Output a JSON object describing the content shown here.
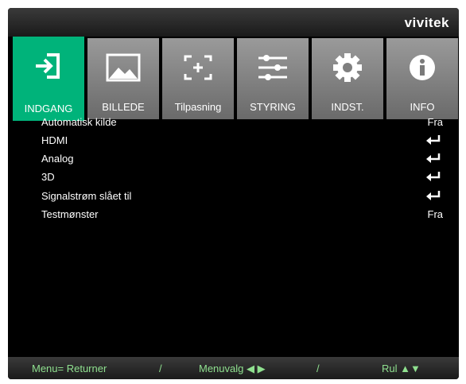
{
  "brand": "vivitek",
  "tabs": [
    {
      "label": "INDGANG",
      "icon": "input-icon",
      "active": true
    },
    {
      "label": "BILLEDE",
      "icon": "image-icon",
      "active": false
    },
    {
      "label": "Tilpasning",
      "icon": "adjust-icon",
      "active": false
    },
    {
      "label": "STYRING",
      "icon": "sliders-icon",
      "active": false
    },
    {
      "label": "INDST.",
      "icon": "gear-icon",
      "active": false
    },
    {
      "label": "INFO",
      "icon": "info-icon",
      "active": false
    }
  ],
  "menu": [
    {
      "label": "Automatisk kilde",
      "value": "Fra"
    },
    {
      "label": "HDMI",
      "value": ""
    },
    {
      "label": "Analog",
      "value": ""
    },
    {
      "label": "3D",
      "value": ""
    },
    {
      "label": "Signalstrøm slået til",
      "value": ""
    },
    {
      "label": "Testmønster",
      "value": "Fra"
    }
  ],
  "footer": {
    "menu_return": "Menu= Returner",
    "sep1": "/",
    "menu_select": "Menuvalg ◀ ▶",
    "sep2": "/",
    "scroll": "Rul ▲▼"
  },
  "colors": {
    "accent": "#00b37a",
    "footer_text": "#8fe08f"
  }
}
